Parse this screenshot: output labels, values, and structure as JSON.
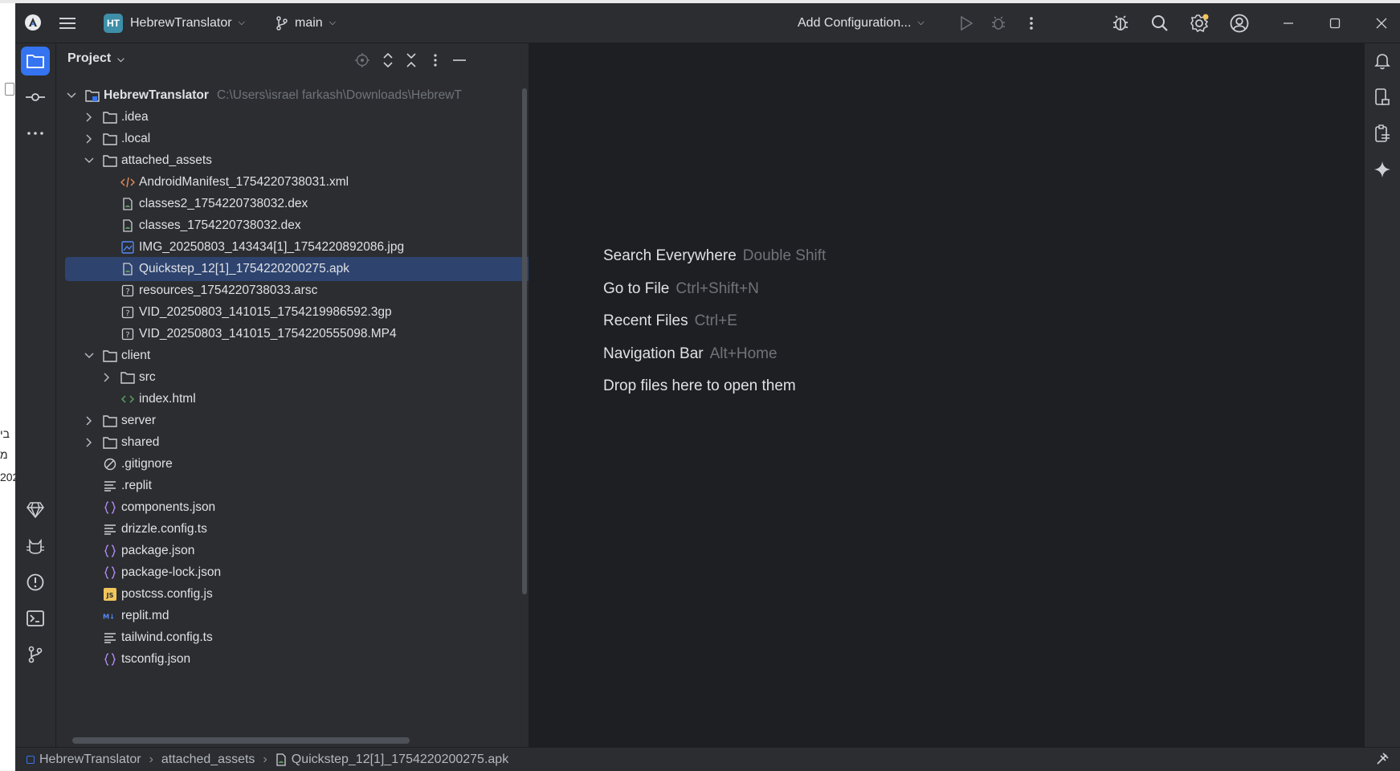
{
  "background": {
    "fragments": [
      "בי",
      "מ",
      "202"
    ]
  },
  "titlebar": {
    "logo_icon": "android-studio-icon",
    "project_badge": "HT",
    "project_name": "HebrewTranslator",
    "branch": "main",
    "run_config": "Add Configuration...",
    "icons": [
      "main-menu-icon",
      "branch-icon",
      "run-icon",
      "debug-icon",
      "more-icon",
      "bug-icon",
      "search-icon",
      "settings-icon",
      "account-icon",
      "minimize-icon",
      "maximize-icon",
      "close-icon"
    ],
    "settings_badge_color": "#f2c55c"
  },
  "left_strip": {
    "top": [
      "project-folder-icon",
      "commit-icon",
      "more-tools-icon"
    ],
    "bottom": [
      "gem-icon",
      "cat-icon",
      "problems-icon",
      "terminal-icon",
      "git-icon"
    ]
  },
  "right_strip": [
    "notifications-icon",
    "device-manager-icon",
    "clipboard-icon",
    "gemini-icon"
  ],
  "project_panel": {
    "title": "Project",
    "header_icons": [
      "locate-icon",
      "expand-all-icon",
      "collapse-all-icon",
      "options-icon",
      "hide-icon"
    ],
    "root": {
      "name": "HebrewTranslator",
      "path": "C:\\Users\\israel farkash\\Downloads\\HebrewT"
    },
    "tree": [
      {
        "label": ".idea",
        "type": "folder",
        "level": 1,
        "expanded": false
      },
      {
        "label": ".local",
        "type": "folder",
        "level": 1,
        "expanded": false
      },
      {
        "label": "attached_assets",
        "type": "folder",
        "level": 1,
        "expanded": true
      },
      {
        "label": "AndroidManifest_1754220738031.xml",
        "type": "xml",
        "level": 2
      },
      {
        "label": "classes2_1754220738032.dex",
        "type": "dex",
        "level": 2
      },
      {
        "label": "classes_1754220738032.dex",
        "type": "dex",
        "level": 2
      },
      {
        "label": "IMG_20250803_143434[1]_1754220892086.jpg",
        "type": "image",
        "level": 2
      },
      {
        "label": "Quickstep_12[1]_1754220200275.apk",
        "type": "apk",
        "level": 2,
        "selected": true
      },
      {
        "label": "resources_1754220738033.arsc",
        "type": "unknown",
        "level": 2
      },
      {
        "label": "VID_20250803_141015_1754219986592.3gp",
        "type": "unknown",
        "level": 2
      },
      {
        "label": "VID_20250803_141015_1754220555098.MP4",
        "type": "unknown",
        "level": 2
      },
      {
        "label": "client",
        "type": "folder",
        "level": 1,
        "expanded": true
      },
      {
        "label": "src",
        "type": "folder",
        "level": 2,
        "expanded": false
      },
      {
        "label": "index.html",
        "type": "html",
        "level": 2
      },
      {
        "label": "server",
        "type": "folder",
        "level": 1,
        "expanded": false
      },
      {
        "label": "shared",
        "type": "folder",
        "level": 1,
        "expanded": false
      },
      {
        "label": ".gitignore",
        "type": "ignore",
        "level": 1
      },
      {
        "label": ".replit",
        "type": "text",
        "level": 1
      },
      {
        "label": "components.json",
        "type": "json",
        "level": 1
      },
      {
        "label": "drizzle.config.ts",
        "type": "text",
        "level": 1
      },
      {
        "label": "package.json",
        "type": "json",
        "level": 1
      },
      {
        "label": "package-lock.json",
        "type": "json",
        "level": 1
      },
      {
        "label": "postcss.config.js",
        "type": "js",
        "level": 1
      },
      {
        "label": "replit.md",
        "type": "md",
        "level": 1
      },
      {
        "label": "tailwind.config.ts",
        "type": "text",
        "level": 1
      },
      {
        "label": "tsconfig.json",
        "type": "json",
        "level": 1
      }
    ]
  },
  "editor": {
    "hints": [
      {
        "action": "Search Everywhere",
        "shortcut": "Double Shift"
      },
      {
        "action": "Go to File",
        "shortcut": "Ctrl+Shift+N"
      },
      {
        "action": "Recent Files",
        "shortcut": "Ctrl+E"
      },
      {
        "action": "Navigation Bar",
        "shortcut": "Alt+Home"
      },
      {
        "action": "Drop files here to open them",
        "shortcut": ""
      }
    ]
  },
  "statusbar": {
    "crumbs": [
      "HebrewTranslator",
      "attached_assets",
      "Quickstep_12[1]_1754220200275.apk"
    ],
    "right_icon": "power-save-icon"
  },
  "colors": {
    "bg": "#1e1f22",
    "panel": "#2b2d30",
    "selection": "#2e436e",
    "accent": "#3574f0",
    "muted": "#6f737a"
  }
}
